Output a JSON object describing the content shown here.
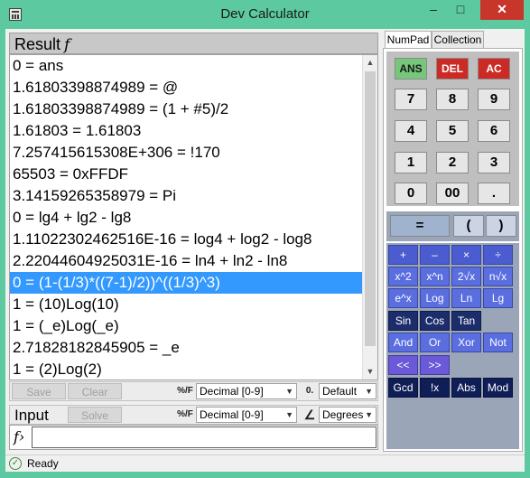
{
  "window": {
    "title": "Dev Calculator",
    "minimize": "–",
    "maximize": "□",
    "close": "✕"
  },
  "result": {
    "label": "Result",
    "fn_symbol": "f",
    "lines": [
      "0 = ans",
      "1.61803398874989 = @",
      "1.61803398874989 = (1 + #5)/2",
      "1.61803 = 1.61803",
      "7.257415615308E+306 = !170",
      "65503 = 0xFFDF",
      "3.14159265358979 = Pi",
      "0 = lg4 + lg2 - lg8",
      "1.11022302462516E-16 = log4 + log2 - log8",
      "2.22044604925031E-16 = ln4 + ln2 - ln8",
      "0 = (1-(1/3)*((7-1)/2))^((1/3)^3)",
      "1 = (10)Log(10)",
      "1 = (_e)Log(_e)",
      "2.71828182845905 = _e",
      "1 = (2)Log(2)"
    ],
    "selected_index": 10,
    "scroll_up": "▲",
    "scroll_down": "▼"
  },
  "result_toolbar": {
    "save": "Save",
    "clear": "Clear",
    "format_icon": "%/F",
    "number_format": "Decimal [0-9]",
    "precision_icon": "0.",
    "precision": "Default",
    "caret": "▼"
  },
  "input": {
    "label": "Input",
    "solve": "Solve",
    "format_icon": "%/F",
    "number_format": "Decimal [0-9]",
    "angle_icon": "∠",
    "angle_unit": "Degrees",
    "caret": "▼",
    "prompt": "f›",
    "value": ""
  },
  "status": {
    "icon": "✓",
    "text": "Ready"
  },
  "tabs": [
    "NumPad",
    "Collection"
  ],
  "numpad": {
    "ans": "ANS",
    "del": "DEL",
    "ac": "AC",
    "digits": [
      "7",
      "8",
      "9",
      "4",
      "5",
      "6",
      "1",
      "2",
      "3",
      "0",
      "00",
      "."
    ],
    "equals": "=",
    "lparen": "(",
    "rparen": ")",
    "ops": [
      "+",
      "–",
      "×",
      "÷"
    ],
    "pow": [
      "x^2",
      "x^n",
      "2√x",
      "n√x"
    ],
    "logs": [
      "e^x",
      "Log",
      "Ln",
      "Lg"
    ],
    "trig": [
      "Sin",
      "Cos",
      "Tan"
    ],
    "bit": [
      "And",
      "Or",
      "Xor",
      "Not"
    ],
    "shift": [
      "<<",
      ">>"
    ],
    "misc": [
      "Gcd",
      "!x",
      "Abs",
      "Mod"
    ]
  }
}
